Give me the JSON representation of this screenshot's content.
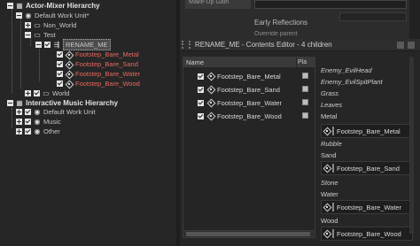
{
  "hierarchy": {
    "actor_mixer_header": "Actor-Mixer Hierarchy",
    "default_work_unit": "Default Work Unit*",
    "non_world": "Non_World",
    "test": "Test",
    "rename_me": "RENAME_ME",
    "children": [
      "Footstep_Bare_Metal",
      "Footstep_Bare_Sand",
      "Footstep_Bare_Water",
      "Footstep_Bare_Wood"
    ],
    "world": "World",
    "interactive_header": "Interactive Music Hierarchy",
    "im_default_work_unit": "Default Work Unit",
    "music": "Music",
    "other": "Other"
  },
  "property_editor": {
    "makeup_gain": "Make-Up Gain",
    "early_reflections": "Early Reflections",
    "override_parent": "Override parent"
  },
  "contents_editor": {
    "title": "RENAME_ME - Contents Editor - 4 children",
    "col_name": "Name",
    "col_play": "Pla",
    "rows": [
      "Footstep_Bare_Metal",
      "Footstep_Bare_Sand",
      "Footstep_Bare_Water",
      "Footstep_Bare_Wood"
    ]
  },
  "assign": {
    "enemy_evil_head": "Enemy_EvilHead",
    "enemy_evil_spit_plant": "Enemy_EvilSpitPlant",
    "grass": "Grass",
    "leaves": "Leaves",
    "metal": "Metal",
    "metal_item": "Footstep_Bare_Metal",
    "rubble": "Rubble",
    "sand": "Sand",
    "sand_item": "Footstep_Bare_Sand",
    "stone": "Stone",
    "water": "Water",
    "water_item": "Footstep_Bare_Water",
    "wood": "Wood",
    "wood_item": "Footstep_Bare_Wood"
  },
  "colors": {
    "missing_red": "#e8685f",
    "panel_bg": "#262626"
  }
}
